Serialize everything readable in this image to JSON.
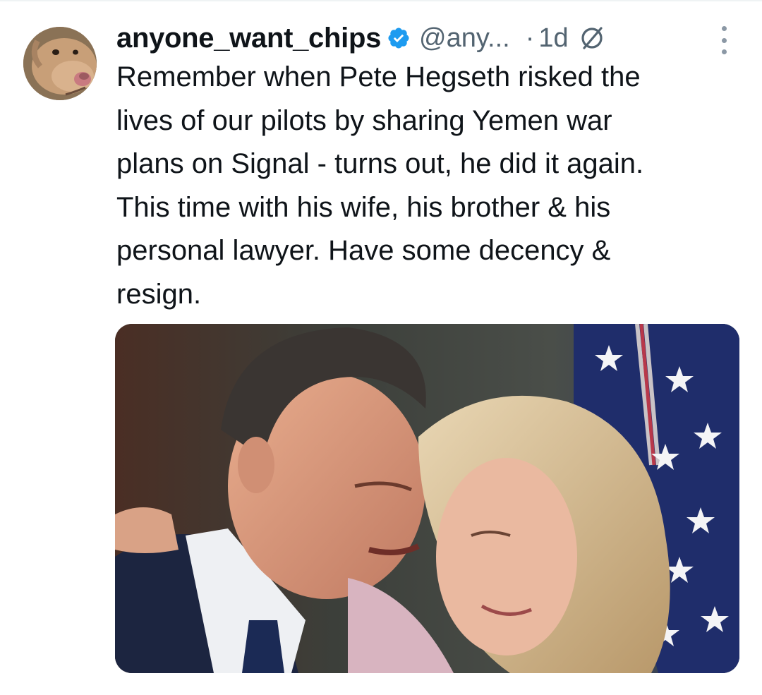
{
  "tweet": {
    "display_name": "anyone_want_chips",
    "handle": "@any...",
    "separator": "·",
    "time": "1d",
    "text": "Remember when Pete Hegseth risked the\nlives of our pilots by sharing Yemen war\nplans on Signal - turns out, he did it again.\nThis time with his wife, his brother & his\npersonal lawyer. Have some decency &\nresign.",
    "icons": {
      "avatar": "dog-avatar",
      "verified": "verified-badge-icon",
      "grok": "grok-icon",
      "more": "more-options-icon"
    },
    "colors": {
      "verified": "#1d9bf0",
      "secondary_text": "#536471",
      "primary_text": "#0f1419"
    }
  }
}
